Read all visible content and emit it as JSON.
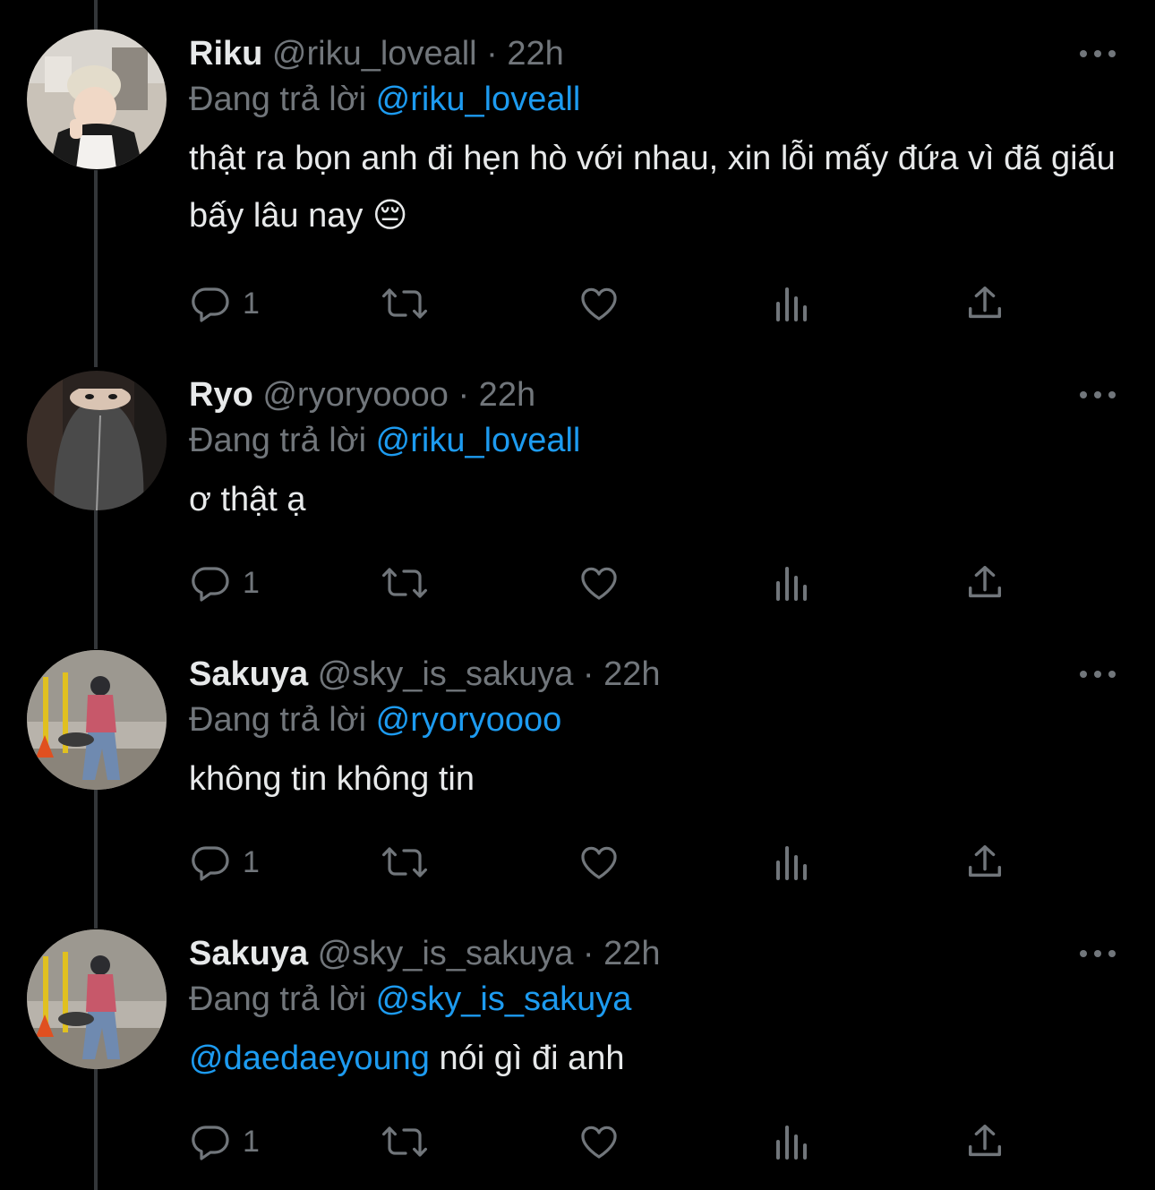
{
  "colors": {
    "background": "#000000",
    "text_primary": "#e7e9ea",
    "text_secondary": "#71767b",
    "accent_link": "#1d9bf0",
    "thread_line": "#333639"
  },
  "tweets": [
    {
      "display_name": "Riku",
      "meta": "@riku_loveall · 22h",
      "reply_prefix": "Đang trả lời",
      "reply_to": "@riku_loveall",
      "text_mention": "",
      "text": "thật ra bọn anh đi hẹn hò với nhau, xin lỗi mấy đứa vì đã giấu bấy lâu nay 😔",
      "reply_count": "1",
      "icons": [
        "reply-icon",
        "retweet-icon",
        "like-icon",
        "views-icon",
        "share-icon",
        "more-icon"
      ]
    },
    {
      "display_name": "Ryo",
      "meta": "@ryoryoooo · 22h",
      "reply_prefix": "Đang trả lời",
      "reply_to": "@riku_loveall",
      "text_mention": "",
      "text": "ơ thật ạ",
      "reply_count": "1",
      "icons": [
        "reply-icon",
        "retweet-icon",
        "like-icon",
        "views-icon",
        "share-icon",
        "more-icon"
      ]
    },
    {
      "display_name": "Sakuya",
      "meta": "@sky_is_sakuya · 22h",
      "reply_prefix": "Đang trả lời",
      "reply_to": "@ryoryoooo",
      "text_mention": "",
      "text": "không tin không tin",
      "reply_count": "1",
      "icons": [
        "reply-icon",
        "retweet-icon",
        "like-icon",
        "views-icon",
        "share-icon",
        "more-icon"
      ]
    },
    {
      "display_name": "Sakuya",
      "meta": "@sky_is_sakuya · 22h",
      "reply_prefix": "Đang trả lời",
      "reply_to": "@sky_is_sakuya",
      "text_mention": "@daedaeyoung",
      "text": " nói gì đi anh",
      "reply_count": "1",
      "icons": [
        "reply-icon",
        "retweet-icon",
        "like-icon",
        "views-icon",
        "share-icon",
        "more-icon"
      ]
    }
  ]
}
